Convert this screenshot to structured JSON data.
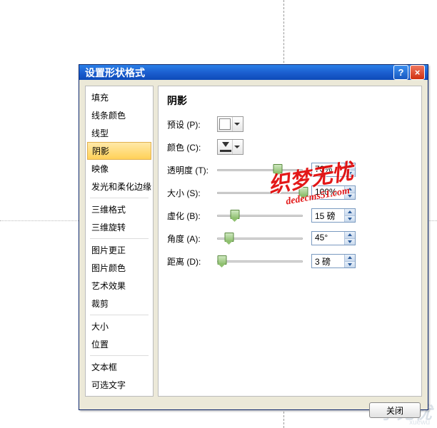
{
  "dialog": {
    "title": "设置形状格式",
    "help_btn": "?",
    "close_btn": "×"
  },
  "sidebar": {
    "items": [
      {
        "label": "填充"
      },
      {
        "label": "线条颜色"
      },
      {
        "label": "线型"
      },
      {
        "label": "阴影",
        "selected": true
      },
      {
        "label": "映像"
      },
      {
        "label": "发光和柔化边缘"
      },
      {
        "sep": true
      },
      {
        "label": "三维格式"
      },
      {
        "label": "三维旋转"
      },
      {
        "sep": true
      },
      {
        "label": "图片更正"
      },
      {
        "label": "图片颜色"
      },
      {
        "label": "艺术效果"
      },
      {
        "label": "裁剪"
      },
      {
        "sep": true
      },
      {
        "label": "大小"
      },
      {
        "label": "位置"
      },
      {
        "sep": true
      },
      {
        "label": "文本框"
      },
      {
        "label": "可选文字"
      }
    ]
  },
  "panel": {
    "title": "阴影",
    "preset_label": "预设 (P)",
    "color_label": "颜色 (C)",
    "rows": [
      {
        "label": "透明度 (T)",
        "pos": 70,
        "value": "70%"
      },
      {
        "label": "大小 (S)",
        "pos": 100,
        "value": "100%"
      },
      {
        "label": "虚化 (B)",
        "pos": 20,
        "value": "15 磅"
      },
      {
        "label": "角度 (A)",
        "pos": 13,
        "value": "45°"
      },
      {
        "label": "距离 (D)",
        "pos": 5,
        "value": "3 磅"
      }
    ]
  },
  "footer": {
    "close_label": "关闭"
  },
  "watermark": {
    "main": "织梦无忧",
    "sub": "dedecms51.com"
  },
  "bg_watermark": {
    "main": "学无忧",
    "sub": "xuewu"
  }
}
